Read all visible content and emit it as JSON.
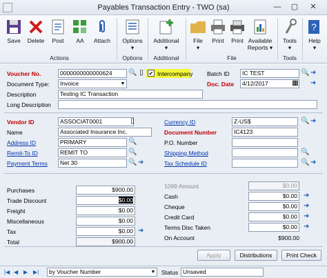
{
  "window": {
    "title": "Payables Transaction Entry  -  TWO (sa)",
    "min": "—",
    "max": "▢",
    "close": "✕"
  },
  "ribbon": {
    "save": "Save",
    "delete": "Delete",
    "post": "Post",
    "aa": "AA",
    "attach": "Attach",
    "options": "Options",
    "additional": "Additional",
    "file": "File",
    "print": "Print",
    "print2": "Print",
    "reports": "Available\nReports",
    "tools": "Tools",
    "help": "Help",
    "groups": {
      "actions": "Actions",
      "options": "Options",
      "additional": "Additional",
      "file": "File",
      "tools": "Tools"
    }
  },
  "form": {
    "voucher_no_label": "Voucher No.",
    "voucher_no": "0000000000000624",
    "intercompany_label": "Intercompany",
    "intercompany_checked": true,
    "batch_id_label": "Batch ID",
    "batch_id": "IC TEST",
    "doc_type_label": "Document Type:",
    "doc_type": "Invoice",
    "doc_date_label": "Doc. Date",
    "doc_date": "4/12/2017",
    "description_label": "Description",
    "description": "Testing IC Transaction",
    "long_description_label": "Long Description",
    "long_description": "",
    "vendor_id_label": "Vendor ID",
    "vendor_id": "ASSOCIAT0001",
    "name_label": "Name",
    "name": "Associated Insurance Inc.",
    "address_id_label": "Address ID",
    "address_id": "PRIMARY",
    "remit_to_label": "Remit-To ID",
    "remit_to": "REMIT TO",
    "payment_terms_label": "Payment Terms",
    "payment_terms": "Net 30",
    "currency_id_label": "Currency ID",
    "currency_id": "Z-US$",
    "document_number_label": "Document Number",
    "document_number": "IC4123",
    "po_number_label": "P.O. Number",
    "po_number": "",
    "shipping_method_label": "Shipping Method",
    "shipping_method": "",
    "tax_schedule_label": "Tax Schedule ID",
    "tax_schedule": "",
    "purchases_label": "Purchases",
    "purchases": "$900.00",
    "trade_discount_label": "Trade Discount",
    "trade_discount": "$0.00",
    "freight_label": "Freight",
    "freight": "$0.00",
    "misc_label": "Miscellaneous",
    "misc": "$0.00",
    "tax_label": "Tax",
    "tax": "$0.00",
    "total_label": "Total",
    "total": "$900.00",
    "amount_1099_label": "1099 Amount",
    "amount_1099": "$0.00",
    "cash_label": "Cash",
    "cash": "$0.00",
    "cheque_label": "Cheque",
    "cheque": "$0.00",
    "credit_card_label": "Credit Card",
    "credit_card": "$0.00",
    "terms_disc_label": "Terms Disc Taken",
    "terms_disc": "$0.00",
    "on_account_label": "On Account",
    "on_account": "$900.00"
  },
  "buttons": {
    "apply": "Apply",
    "distributions": "Distributions",
    "print_check": "Print Check"
  },
  "status": {
    "sort": "by Voucher Number",
    "status_label": "Status",
    "status": "Unsaved"
  }
}
